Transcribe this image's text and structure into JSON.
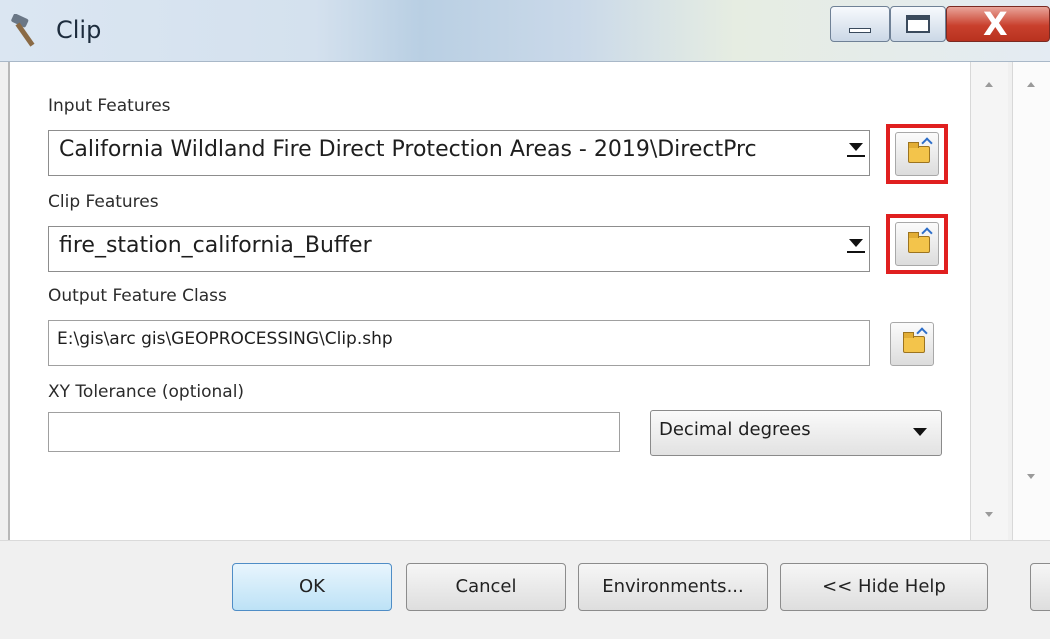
{
  "window": {
    "title": "Clip",
    "controls": {
      "minimize": "minimize",
      "maximize": "maximize",
      "close": "X"
    }
  },
  "form": {
    "input_features": {
      "label": "Input Features",
      "value": "California Wildland Fire Direct Protection Areas - 2019\\DirectPrc"
    },
    "clip_features": {
      "label": "Clip Features",
      "value": "fire_station_california_Buffer"
    },
    "output_feature_class": {
      "label": "Output Feature Class",
      "value": "E:\\gis\\arc gis\\GEOPROCESSING\\Clip.shp"
    },
    "xy_tolerance": {
      "label": "XY Tolerance (optional)",
      "value": "",
      "unit": "Decimal degrees"
    }
  },
  "buttons": {
    "ok": "OK",
    "cancel": "Cancel",
    "environments": "Environments...",
    "hide_help": "<< Hide Help"
  },
  "highlight_color": "#e01f1f",
  "icons": [
    "hammer-icon",
    "folder-open-icon",
    "dropdown-arrow-icon"
  ]
}
